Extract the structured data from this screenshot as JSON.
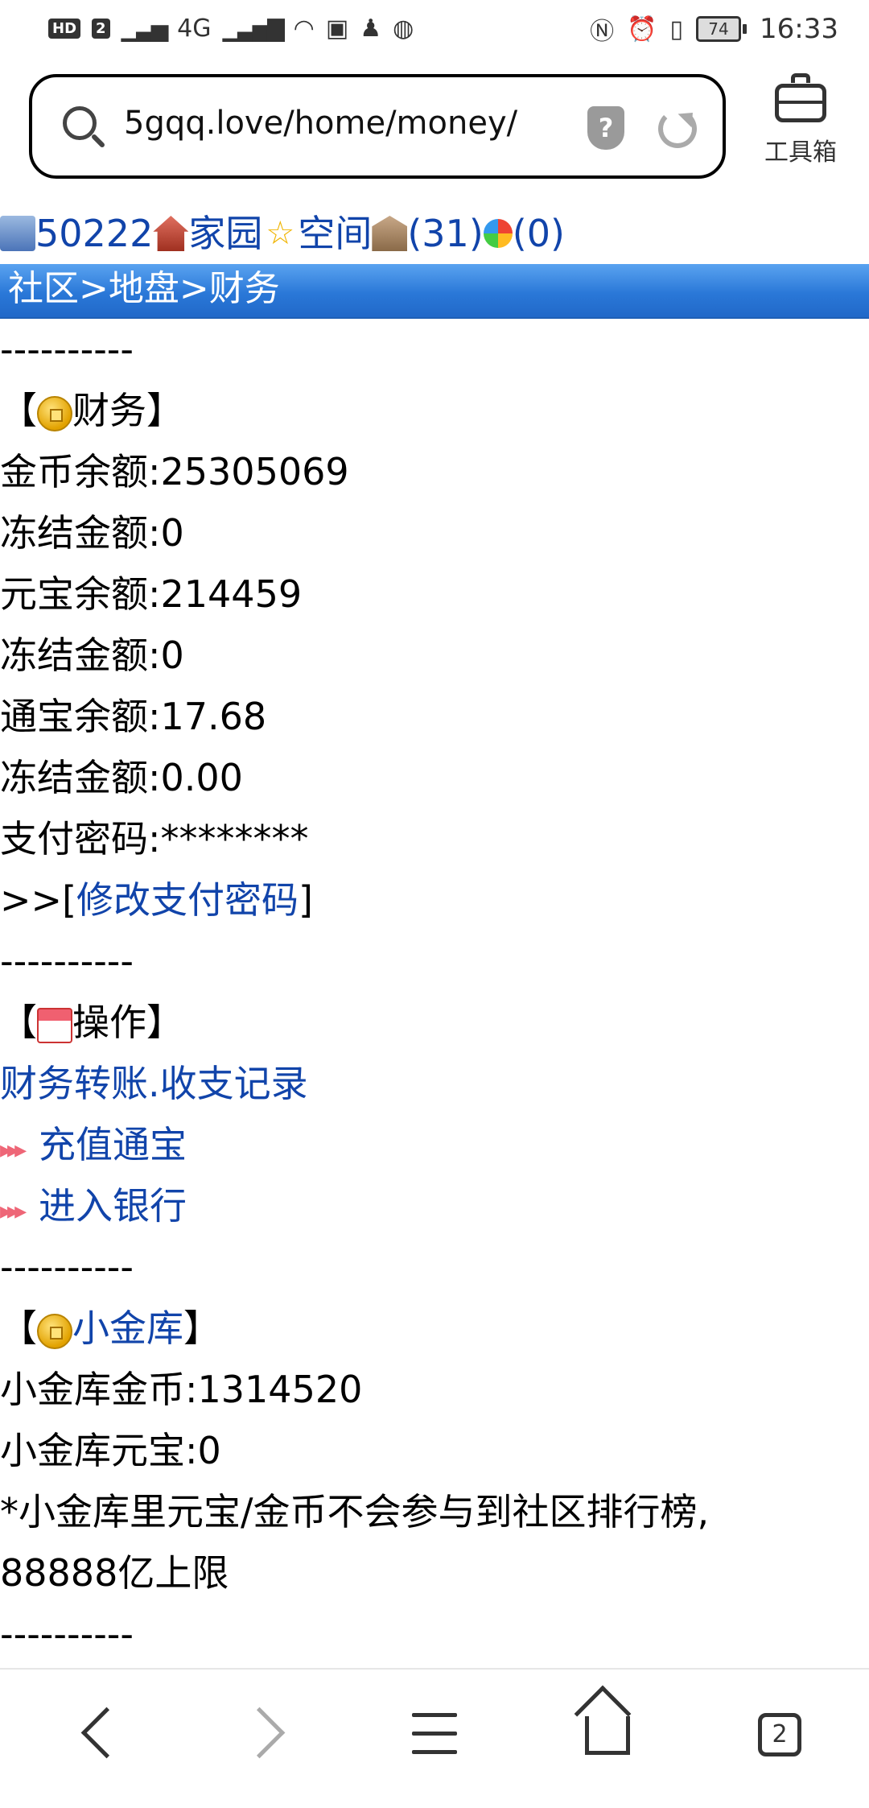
{
  "status_bar": {
    "left_badges": [
      "HD",
      "2"
    ],
    "network": "4G",
    "battery": "74",
    "time": "16:33"
  },
  "browser": {
    "url": "5gqq.love/home/money/",
    "toolbox_label": "工具箱"
  },
  "nav": {
    "user_id": "50222",
    "home": "家园",
    "space": "空间",
    "count1": "(31)",
    "count2": "(0)"
  },
  "breadcrumb": "社区>地盘>财务",
  "divider": "----------",
  "finance": {
    "title_open": "【",
    "title": "财务",
    "title_close": "】",
    "rows": [
      "金币余额:25305069",
      "冻结金额:0",
      "元宝余额:214459",
      "冻结金额:0",
      "通宝余额:17.68",
      "冻结金额:0.00",
      "支付密码:********"
    ],
    "change_prefix": ">>[",
    "change_link": "修改支付密码",
    "change_suffix": "]"
  },
  "operations": {
    "title": "操作",
    "transfer_link": "财务转账",
    "dot": ".",
    "records_link": "收支记录",
    "recharge_link": "充值通宝",
    "bank_link": "进入银行"
  },
  "vault": {
    "title_link": "小金库",
    "rows": [
      "小金库金币:1314520",
      "小金库元宝:0",
      "*小金库里元宝/金币不会参与到社区排行榜,",
      "88888亿上限"
    ]
  },
  "bottom_nav": {
    "tab_count": "2"
  }
}
